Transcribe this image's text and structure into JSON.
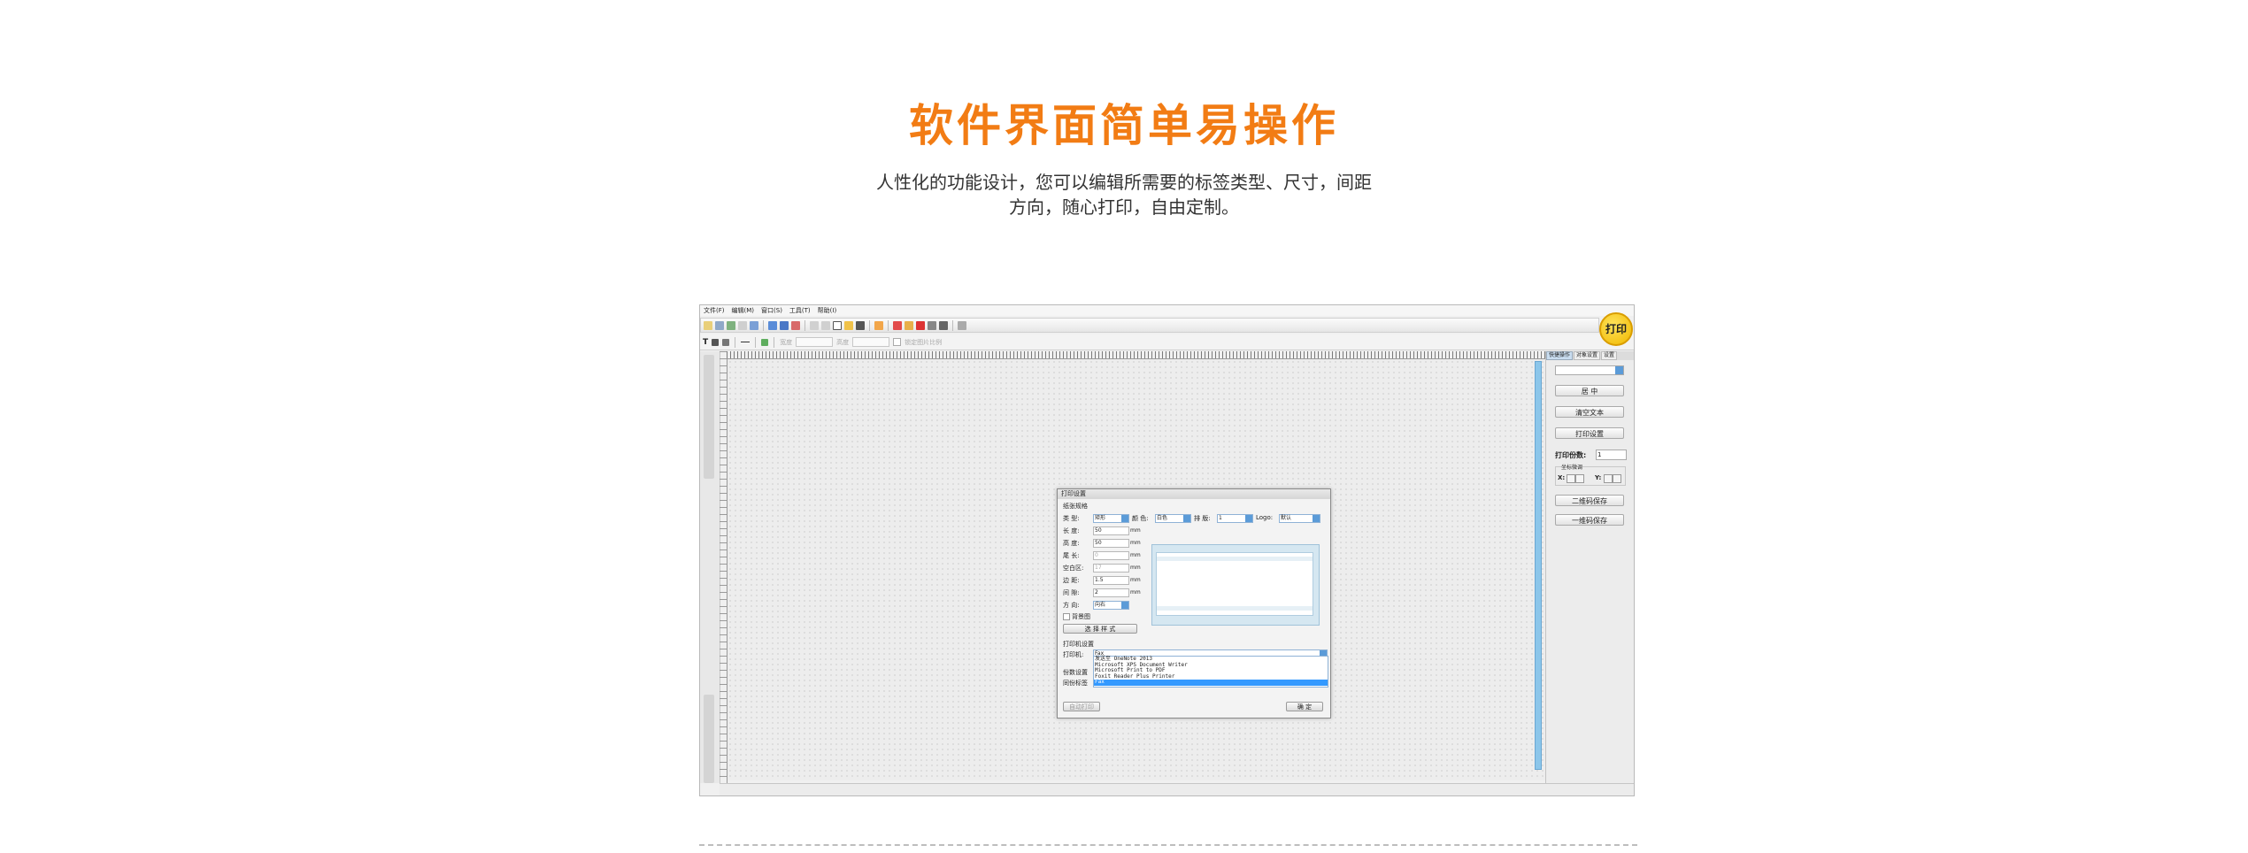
{
  "hero": {
    "title": "软件界面简单易操作",
    "subtitle_line1": "人性化的功能设计，您可以编辑所需要的标签类型、尺寸，间距",
    "subtitle_line2": "方向，随心打印，自由定制。"
  },
  "app": {
    "menu": [
      "文件(F)",
      "编辑(M)",
      "窗口(S)",
      "工具(T)",
      "帮助(I)"
    ],
    "print_badge": "打印",
    "toolbar2": {
      "text_tool": "T",
      "disabled_a": "宽度",
      "disabled_b": "高度",
      "lock_label": "锁定图片比例"
    },
    "right_panel": {
      "tabs": [
        "快捷操作",
        "对象设置",
        "设置"
      ],
      "buttons": [
        "居 中",
        "清空文本",
        "打印设置"
      ],
      "copies_label": "打印份数:",
      "copies_value": "1",
      "coord_label": "坐标微调",
      "x_label": "X:",
      "y_label": "Y:",
      "buttons2": [
        "二维码保存",
        "一维码保存"
      ]
    },
    "dialog": {
      "title": "打印设置",
      "group1": "纸张规格",
      "type_label": "类  型:",
      "type_value": "矩形",
      "color_label": "颜  色:",
      "color_value": "白色",
      "row_label": "排  版:",
      "row_value": "1",
      "logo_label": "Logo:",
      "logo_value": "默认",
      "length_label": "长  度:",
      "length_value": "50",
      "height_label": "高  度:",
      "height_value": "50",
      "tail_label": "尾  长:",
      "tail_value": "0",
      "blank_label": "空白区:",
      "blank_value": "17",
      "margin_label": "边  距:",
      "margin_value": "1.5",
      "gap_label": "间  隙:",
      "gap_value": "2",
      "dir_label": "方  向:",
      "dir_value": "向右",
      "unit": "mm",
      "bg_check": "背景图",
      "style_btn": "选 择 样 式",
      "group2": "打印机设置",
      "printer_label": "打印机:",
      "printer_value": "Fax",
      "printer_list": [
        "发送至 OneNote 2013",
        "Microsoft XPS Document Writer",
        "Microsoft Print to PDF",
        "Foxit Reader Plus Printer",
        "Fax"
      ],
      "copies_row_label": "份数设置",
      "sync_label": "同份标签",
      "auto_btn": "自动打印",
      "ok_btn": "确  定"
    }
  }
}
